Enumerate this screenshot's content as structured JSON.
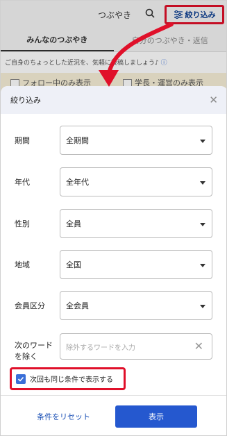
{
  "background": {
    "title": "つぶやき",
    "filter_button_label": "絞り込み",
    "tabs": [
      {
        "label": "みんなのつぶやき"
      },
      {
        "label": "自分のつぶやき・返信"
      }
    ],
    "notice": "ご自身のちょっとした近況を、気軽に投稿しましょう♪",
    "checkboxes": [
      {
        "label": "フォロー中のみ表示"
      },
      {
        "label": "学長・運営のみ表示"
      }
    ]
  },
  "modal": {
    "title": "絞り込み",
    "fields": [
      {
        "label": "期間",
        "value": "全期間"
      },
      {
        "label": "年代",
        "value": "全年代"
      },
      {
        "label": "性別",
        "value": "全員"
      },
      {
        "label": "地域",
        "value": "全国"
      },
      {
        "label": "会員区分",
        "value": "全会員"
      }
    ],
    "exclude": {
      "label": "次のワードを除く",
      "placeholder": "除外するワードを入力"
    },
    "remember_label": "次回も同じ条件で表示する",
    "remember_checked": true,
    "reset_label": "条件をリセット",
    "submit_label": "表示"
  },
  "colors": {
    "highlight": "#e0102a",
    "primary": "#2558cf",
    "link": "#1a4fb5"
  }
}
